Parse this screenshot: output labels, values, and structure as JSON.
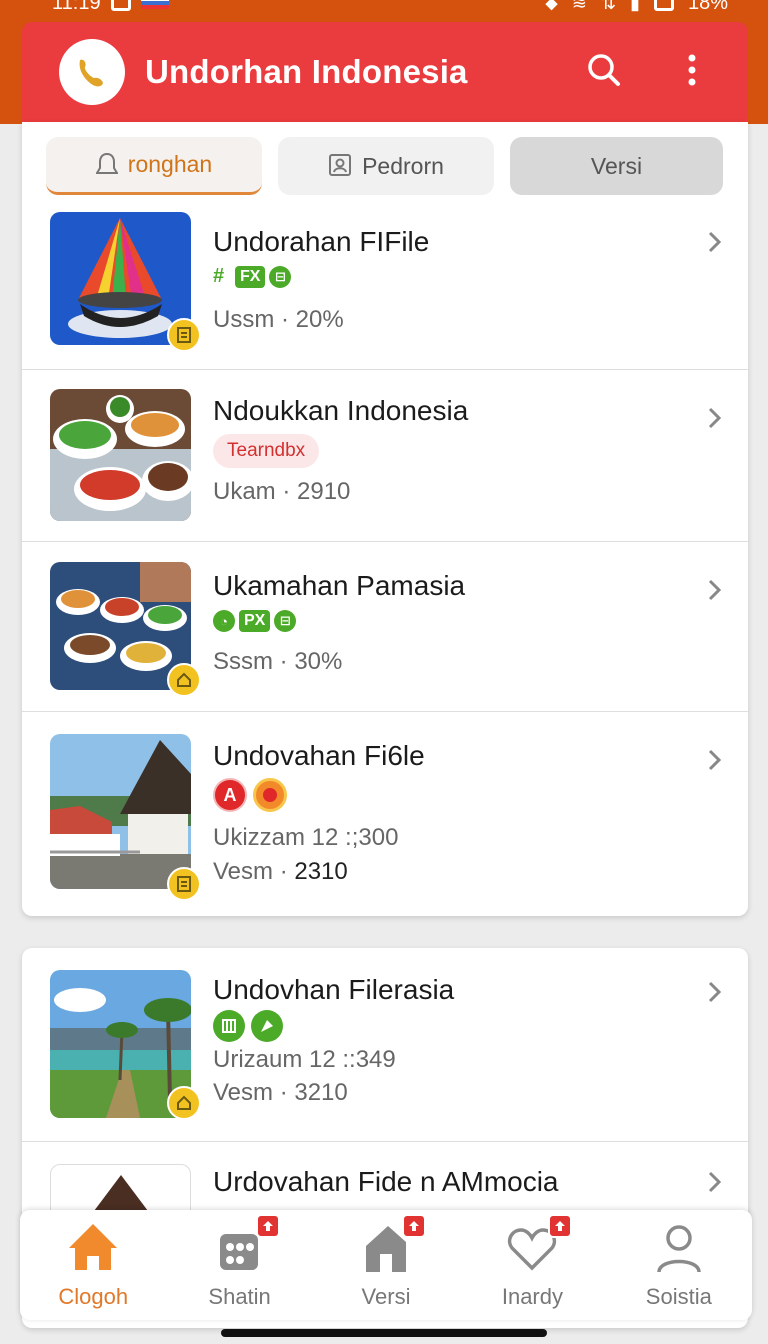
{
  "status": {
    "time": "11:19",
    "battery": "18%"
  },
  "app": {
    "title": "Undorhan Indonesia"
  },
  "tabs": [
    {
      "label": "ronghan",
      "icon": "bell-icon",
      "active": true
    },
    {
      "label": "Pedrorn",
      "icon": "id-card-icon",
      "active": false
    },
    {
      "label": "Versi",
      "icon": "",
      "active": false
    }
  ],
  "items": [
    {
      "title": "Undorahan FIFile",
      "tags": [
        "#",
        "FX",
        "⊟"
      ],
      "sub1": "Ussm · 20%",
      "sub2": ""
    },
    {
      "title": "Ndoukkan Indonesia",
      "pill": "Tearndbx",
      "sub1": "Ukam · 2910",
      "sub2": ""
    },
    {
      "title": "Ukamahan Pamasia",
      "tags": [
        "◔",
        "PX",
        "⊟"
      ],
      "sub1": "Sssm · 30%",
      "sub2": ""
    },
    {
      "title": "Undovahan Fi6le",
      "sub1": "Ukizzam 12 :;300",
      "sub2_prefix": "Vesm · ",
      "sub2_value": "2310"
    },
    {
      "title": "Undovhan Filerasia",
      "sub1": "Urizaum 12 ::349",
      "sub2": "Vesm · 3210"
    },
    {
      "title": "Urdovahan Fide n AMmocia"
    }
  ],
  "nav": [
    {
      "label": "Clogoh",
      "icon": "home-icon",
      "active": true
    },
    {
      "label": "Shatin",
      "icon": "store-icon",
      "active": false
    },
    {
      "label": "Versi",
      "icon": "house-icon",
      "active": false
    },
    {
      "label": "Inardy",
      "icon": "heart-icon",
      "active": false
    },
    {
      "label": "Soistia",
      "icon": "person-icon",
      "active": false
    }
  ],
  "colors": {
    "status_bar": "#d5520e",
    "app_bar": "#ea3b3e",
    "accent": "#e0782a",
    "tag_green": "#4caa29"
  }
}
